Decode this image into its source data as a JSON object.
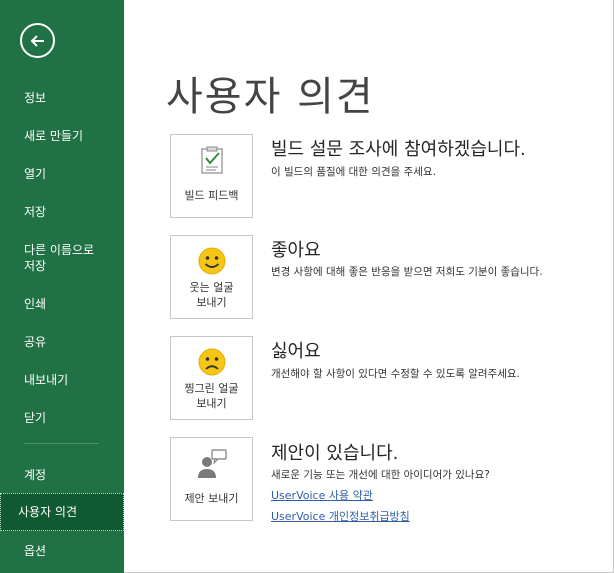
{
  "sidebar": {
    "back_label": "뒤로",
    "items": [
      {
        "label": "정보"
      },
      {
        "label": "새로 만들기"
      },
      {
        "label": "열기"
      },
      {
        "label": "저장"
      },
      {
        "label": "다른 이름으로\n저장"
      },
      {
        "label": "인쇄"
      },
      {
        "label": "공유"
      },
      {
        "label": "내보내기"
      },
      {
        "label": "닫기"
      },
      {
        "label": "계정"
      },
      {
        "label": "사용자 의견"
      },
      {
        "label": "옵션"
      }
    ],
    "active_item": "사용자 의견"
  },
  "main": {
    "title": "사용자 의견",
    "options": [
      {
        "card_label": "빌드 피드백",
        "title": "빌드 설문 조사에 참여하겠습니다.",
        "description": "이 빌드의 품질에 대한 의견을 주세요.",
        "icon": "clipboard-check-icon"
      },
      {
        "card_label": "웃는 얼굴\n보내기",
        "title": "좋아요",
        "description": "변경 사항에 대해 좋은 반응을 받으면 저희도 기분이 좋습니다.",
        "icon": "smile-face-icon"
      },
      {
        "card_label": "찡그린 얼굴\n보내기",
        "title": "싫어요",
        "description": "개선해야 할 사항이 있다면 수정할 수 있도록 알려주세요.",
        "icon": "frown-face-icon"
      },
      {
        "card_label": "제안 보내기",
        "title": "제안이 있습니다.",
        "description": "새로운 기능 또는 개선에 대한 아이디어가 있나요?",
        "icon": "person-speech-icon",
        "links": [
          "UserVoice 사용 약관",
          "UserVoice 개인정보취급방침"
        ]
      }
    ]
  },
  "colors": {
    "sidebar_bg": "#207245",
    "sidebar_active": "#0f5a31",
    "smiley": "#f5c518",
    "link": "#2e5fa8"
  }
}
